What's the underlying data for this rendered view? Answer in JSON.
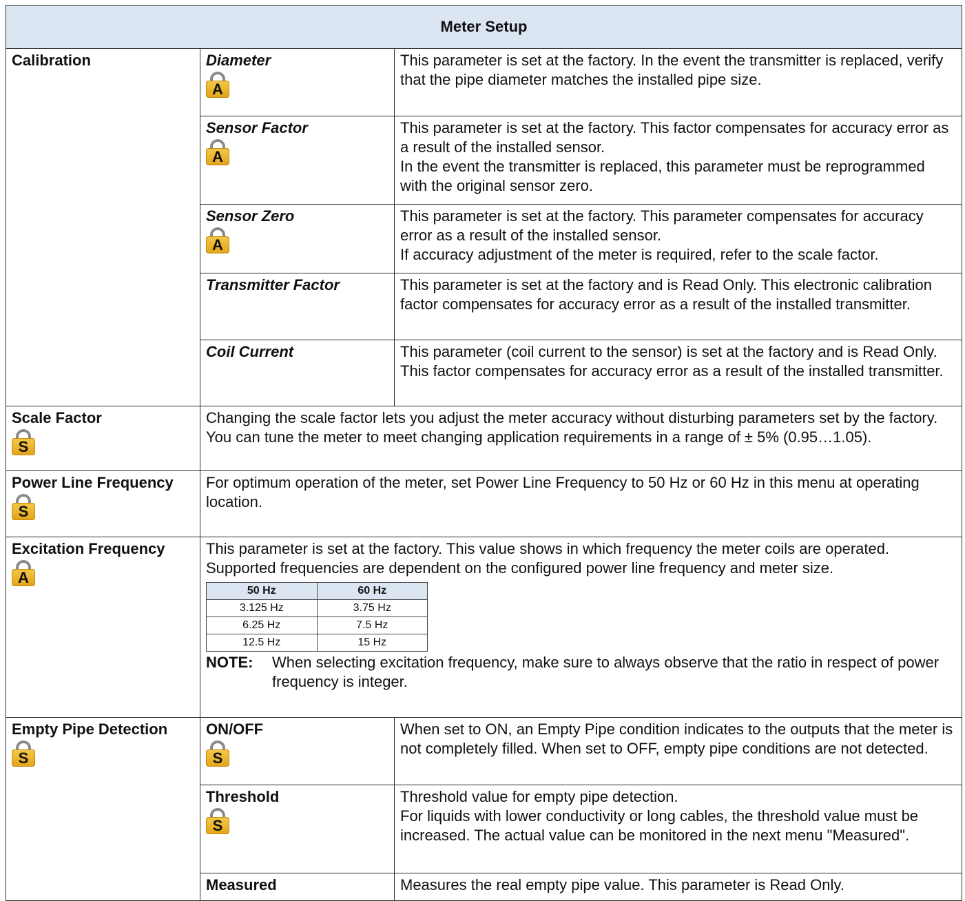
{
  "title": "Meter Setup",
  "calibration": {
    "label": "Calibration",
    "params": [
      {
        "name": "Diameter",
        "lock": "A",
        "desc": "This parameter is set at the factory. In the event the transmitter is replaced, verify that the pipe diameter matches the installed pipe size."
      },
      {
        "name": "Sensor Factor",
        "lock": "A",
        "desc": "This parameter is set at the factory. This factor compensates for accuracy error as a result of the installed sensor.",
        "desc2": "In the event the transmitter is replaced, this parameter must be reprogrammed with the original sensor zero."
      },
      {
        "name": "Sensor Zero",
        "lock": "A",
        "desc": "This parameter is set at the factory. This parameter compensates for accuracy error as a result of the installed sensor.",
        "desc2": "If accuracy adjustment of the meter is required, refer to the scale factor."
      },
      {
        "name": "Transmitter Factor",
        "desc": "This parameter is set at the factory and is Read Only. This electronic calibration factor compensates for accuracy error as a result of the installed transmitter."
      },
      {
        "name": "Coil Current",
        "desc": "This parameter (coil current to the sensor) is set at the factory and is Read Only. This factor compensates for accuracy error as a result of the installed transmitter."
      }
    ]
  },
  "scale_factor": {
    "label": "Scale Factor",
    "lock": "S",
    "desc": "Changing the scale factor lets you adjust the meter accuracy without disturbing parameters set by the factory. You can tune the meter to meet changing application requirements in a range of ± 5% (0.95…1.05)."
  },
  "power_line": {
    "label": "Power Line Frequency",
    "lock": "S",
    "desc": "For optimum operation of the meter, set Power Line Frequency to 50 Hz or 60 Hz in this menu at operating location."
  },
  "excitation": {
    "label": "Excitation Frequency",
    "lock": "A",
    "desc": "This parameter is set at the factory. This value shows in which frequency the meter coils are operated. Supported frequencies are dependent on the configured power line frequency and meter size.",
    "table": {
      "headers": [
        "50 Hz",
        "60 Hz"
      ],
      "rows": [
        [
          "3.125 Hz",
          "3.75 Hz"
        ],
        [
          "6.25 Hz",
          "7.5 Hz"
        ],
        [
          "12.5 Hz",
          "15 Hz"
        ]
      ]
    },
    "note_label": "NOTE:",
    "note": "When selecting excitation frequency, make sure to always observe that the ratio in respect of power frequency is integer."
  },
  "empty_pipe": {
    "label": "Empty Pipe Detection",
    "lock": "S",
    "params": [
      {
        "name": "ON/OFF",
        "lock": "S",
        "desc": "When set to ON, an Empty Pipe condition indicates to the outputs that the meter is not completely filled. When set to OFF, empty pipe conditions are not detected."
      },
      {
        "name": "Threshold",
        "lock": "S",
        "desc": "Threshold value for empty pipe detection.",
        "desc2": "For liquids with lower conductivity or long cables, the threshold value must be increased. The actual value can be monitored in the next menu \"Measured\"."
      },
      {
        "name": "Measured",
        "desc": "Measures the real empty pipe value. This parameter is Read Only."
      }
    ]
  }
}
